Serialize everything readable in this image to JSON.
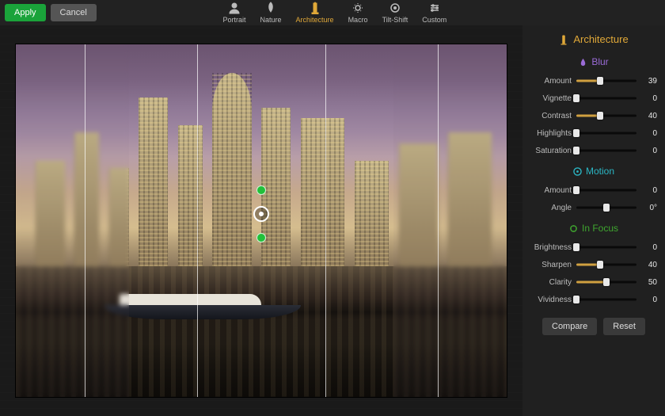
{
  "topbar": {
    "apply_label": "Apply",
    "cancel_label": "Cancel",
    "presets": [
      {
        "key": "portrait",
        "label": "Portrait"
      },
      {
        "key": "nature",
        "label": "Nature"
      },
      {
        "key": "architecture",
        "label": "Architecture"
      },
      {
        "key": "macro",
        "label": "Macro"
      },
      {
        "key": "tiltshift",
        "label": "Tilt-Shift"
      },
      {
        "key": "custom",
        "label": "Custom"
      }
    ],
    "active_preset": "architecture"
  },
  "panel": {
    "title": "Architecture",
    "sections": {
      "blur": {
        "title": "Blur",
        "sliders": [
          {
            "label": "Amount",
            "value": 39,
            "max": 100
          },
          {
            "label": "Vignette",
            "value": 0,
            "max": 100
          },
          {
            "label": "Contrast",
            "value": 40,
            "max": 100
          },
          {
            "label": "Highlights",
            "value": 0,
            "max": 100
          },
          {
            "label": "Saturation",
            "value": 0,
            "max": 100
          }
        ]
      },
      "motion": {
        "title": "Motion",
        "sliders": [
          {
            "label": "Amount",
            "value": 0,
            "max": 100
          },
          {
            "label": "Angle",
            "value": 50,
            "max": 100,
            "display": "0°"
          }
        ]
      },
      "focus": {
        "title": "In Focus",
        "sliders": [
          {
            "label": "Brightness",
            "value": 0,
            "max": 100
          },
          {
            "label": "Sharpen",
            "value": 40,
            "max": 100
          },
          {
            "label": "Clarity",
            "value": 50,
            "max": 100
          },
          {
            "label": "Vividness",
            "value": 0,
            "max": 100
          }
        ]
      }
    },
    "compare_label": "Compare",
    "reset_label": "Reset"
  }
}
